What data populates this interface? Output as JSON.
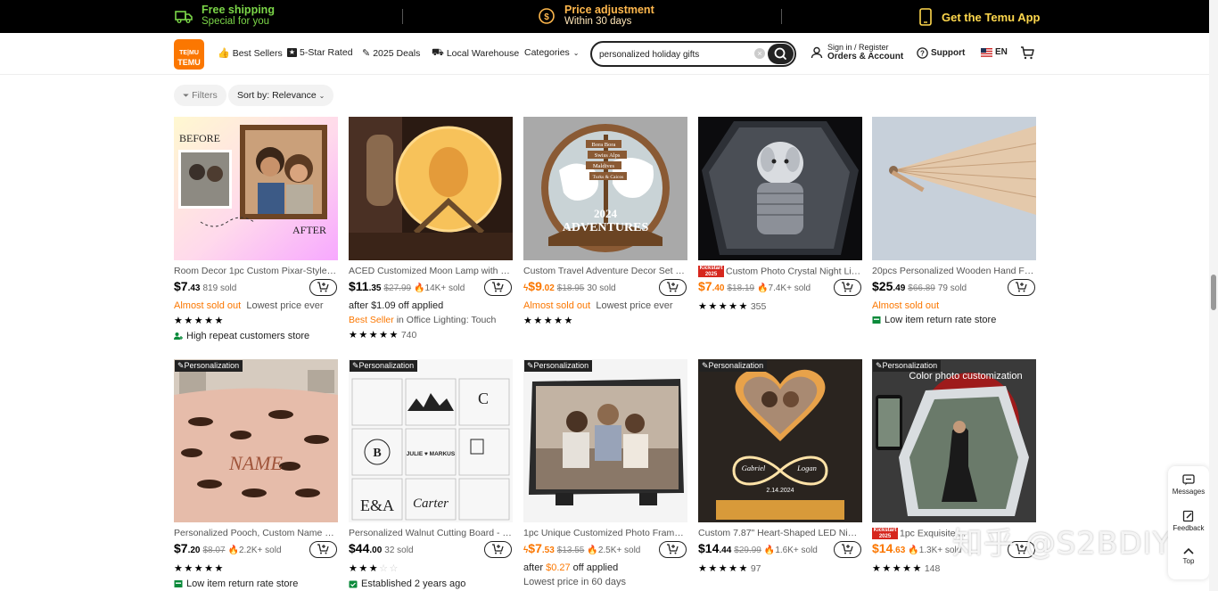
{
  "promo": {
    "shipping_title": "Free shipping",
    "shipping_sub": "Special for you",
    "price_title": "Price adjustment",
    "price_sub": "Within 30 days",
    "app": "Get the Temu App"
  },
  "header": {
    "logo_text_1": "TE|MU",
    "logo_text_2": "TEMU",
    "nav": {
      "best_sellers": "Best Sellers",
      "five_star": "5-Star Rated",
      "deals": "2025 Deals",
      "local": "Local Warehouse",
      "categories": "Categories"
    },
    "search_value": "personalized holiday gifts",
    "sign_in": "Sign in / Register",
    "orders": "Orders & Account",
    "support": "Support",
    "lang": "EN"
  },
  "filters": {
    "filters_label": "Filters",
    "sort_label": "Sort by: Relevance"
  },
  "products": [
    {
      "title": "Room Decor 1pc Custom Pixar-Style Co...",
      "price_main": "$7",
      "price_cents": ".43",
      "sold": "819 sold",
      "line1_orange": "Almost sold out",
      "line1_gray": "Lowest price ever",
      "stars": "★★★★★",
      "badge": "High repeat customers store"
    },
    {
      "title": "ACED Customized Moon Lamp with Per...",
      "price_main": "$11",
      "price_cents": ".35",
      "orig": "$27.99",
      "sold": "14K+ sold",
      "after": "after $1.09 off applied",
      "best_seller": "Best Seller",
      "best_seller_rest": " in Office Lighting: Touch",
      "stars": "★★★★★",
      "reviews": "740"
    },
    {
      "title": "Custom Travel Adventure Decor Set - P...",
      "price_main": "$9",
      "price_cents": ".02",
      "orig": "$18.95",
      "sold": "30 sold",
      "line1_orange": "Almost sold out",
      "line1_gray": "Lowest price ever",
      "stars": "★★★★★"
    },
    {
      "title": "Custom Photo Crystal Night Lig...",
      "kick_1": "Kickstart",
      "kick_2": "2025",
      "price_main": "$7",
      "price_cents": ".40",
      "orig": "$18.19",
      "sold": "7.4K+ sold",
      "stars": "★★★★★",
      "reviews": "355"
    },
    {
      "title": "20pcs Personalized Wooden Hand Fans...",
      "price_main": "$25",
      "price_cents": ".49",
      "orig": "$66.89",
      "sold": "79 sold",
      "line1_orange": "Almost sold out",
      "badge": "Low item return rate store"
    },
    {
      "tag": "Personalization",
      "title": "Personalized Pooch, Custom Name Dac...",
      "price_main": "$7",
      "price_cents": ".20",
      "orig": "$8.07",
      "sold": "2.2K+ sold",
      "stars": "★★★★★",
      "badge": "Low item return rate store"
    },
    {
      "tag": "Personalization",
      "title": "Personalized Walnut Cutting Board - Pe...",
      "price_main": "$44",
      "price_cents": ".00",
      "sold": "32 sold",
      "stars": "★★★",
      "stars_empty": "☆☆",
      "badge": "Established 2 years ago"
    },
    {
      "tag": "Personalization",
      "title": "1pc Unique Customized Photo Frame - ...",
      "price_main": "$7",
      "price_cents": ".53",
      "orig": "$13.55",
      "sold": "2.5K+ sold",
      "after_pre": "after ",
      "after_amt": "$0.27",
      "after_post": " off applied",
      "lowest": "Lowest price in 60 days"
    },
    {
      "tag": "Personalization",
      "title": "Custom 7.87\" Heart-Shaped LED Night ...",
      "price_main": "$14",
      "price_cents": ".44",
      "orig": "$29.99",
      "sold": "1.6K+ sold",
      "stars": "★★★★★",
      "reviews": "97"
    },
    {
      "tag": "Personalization",
      "title": "1pc Exquisite ...",
      "kick_1": "Kickstart",
      "kick_2": "2025",
      "price_main": "$14",
      "price_cents": ".63",
      "sold": "1.3K+ sold",
      "stars": "★★★★★",
      "reviews": "148",
      "img_caption": "Color photo customization"
    }
  ],
  "image_text": {
    "before": "BEFORE",
    "after": "AFTER",
    "adv_year": "2024",
    "adv_word": "ADVENTURES",
    "sign1": "Bora Bora",
    "sign2": "Swiss Alps",
    "sign3": "Maldives",
    "sign4": "Turks & Caicos",
    "blanket_name": "NAME",
    "board_left": "E&A",
    "board_right": "Carter",
    "board_mid": "JULIE ♥ MARKUS",
    "board_b": "B",
    "heart_name1": "Gabriel",
    "heart_name2": "Logan",
    "heart_date": "2.14.2024"
  },
  "side": {
    "messages": "Messages",
    "feedback": "Feedback",
    "top": "Top"
  },
  "watermark": "知乎 @S2BDIY",
  "colors": {
    "brand": "#fb7701",
    "promo_green": "#7bd648",
    "promo_orange": "#ffb84d",
    "promo_yellow": "#ffd84d"
  }
}
